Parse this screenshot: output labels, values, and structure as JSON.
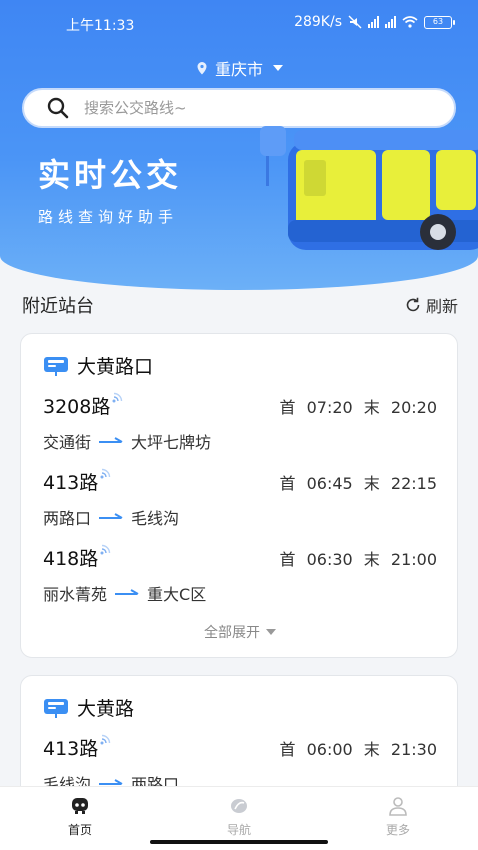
{
  "status_bar": {
    "time": "上午11:33",
    "net_speed": "289K/s",
    "battery": "63"
  },
  "header": {
    "city": "重庆市",
    "search_placeholder": "搜索公交路线~",
    "slogan": "实时公交",
    "subtitle": "路线查询好助手"
  },
  "nearby": {
    "title": "附近站台",
    "refresh_label": "刷新",
    "expand_label": "全部展开",
    "stops": [
      {
        "name": "大黄路口",
        "routes": [
          {
            "name": "3208路",
            "first_label": "首",
            "first": "07:20",
            "last_label": "末",
            "last": "20:20",
            "from": "交通街",
            "to": "大坪七牌坊"
          },
          {
            "name": "413路",
            "first_label": "首",
            "first": "06:45",
            "last_label": "末",
            "last": "22:15",
            "from": "两路口",
            "to": "毛线沟"
          },
          {
            "name": "418路",
            "first_label": "首",
            "first": "06:30",
            "last_label": "末",
            "last": "21:00",
            "from": "丽水菁苑",
            "to": "重大C区"
          }
        ]
      },
      {
        "name": "大黄路",
        "routes": [
          {
            "name": "413路",
            "first_label": "首",
            "first": "06:00",
            "last_label": "末",
            "last": "21:30",
            "from": "毛线沟",
            "to": "两路口"
          }
        ]
      }
    ]
  },
  "bottom_nav": [
    {
      "label": "首页",
      "icon": "home-bus-icon",
      "active": true
    },
    {
      "label": "导航",
      "icon": "navigation-icon",
      "active": false
    },
    {
      "label": "更多",
      "icon": "user-icon",
      "active": false
    }
  ],
  "colors": {
    "brand_blue": "#3f86f3",
    "arrow_blue": "#3b8ff3"
  }
}
